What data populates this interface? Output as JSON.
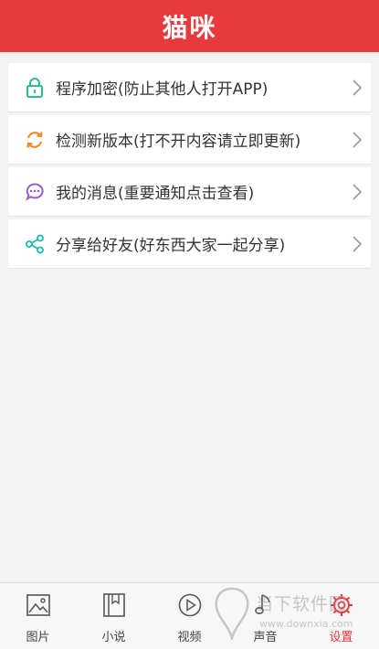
{
  "header": {
    "title": "猫咪",
    "color": "#e8393d"
  },
  "settings": {
    "items": [
      {
        "label": "程序加密(防止其他人打开APP)",
        "icon": "lock-icon",
        "icon_color": "#2ebd8f"
      },
      {
        "label": "检测新版本(打不开内容请立即更新)",
        "icon": "refresh-icon",
        "icon_color": "#f08a24"
      },
      {
        "label": "我的消息(重要通知点击查看)",
        "icon": "message-icon",
        "icon_color": "#9b59d0"
      },
      {
        "label": "分享给好友(好东西大家一起分享)",
        "icon": "share-icon",
        "icon_color": "#1fb8b0"
      }
    ]
  },
  "tabbar": {
    "tabs": [
      {
        "label": "图片",
        "icon": "picture-icon"
      },
      {
        "label": "小说",
        "icon": "book-icon"
      },
      {
        "label": "视频",
        "icon": "play-icon"
      },
      {
        "label": "声音",
        "icon": "sound-icon"
      },
      {
        "label": "设置",
        "icon": "gear-icon",
        "active": true
      }
    ],
    "active_color": "#e8393d"
  },
  "watermark": {
    "text": "当下软件园",
    "url": "www.downxia.com"
  }
}
